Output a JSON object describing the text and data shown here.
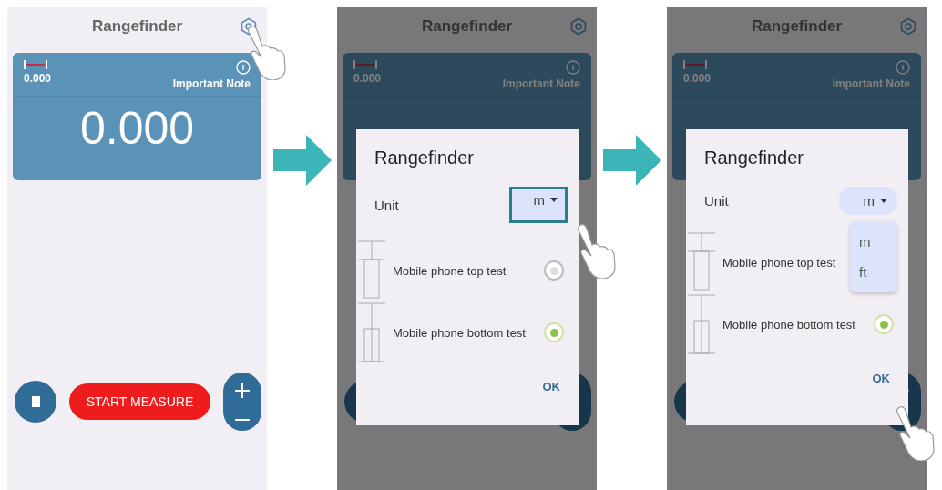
{
  "screens": [
    {
      "title": "Rangefinder",
      "reading": "0.000",
      "note": "Important Note",
      "value": "0.000",
      "start_label": "START MEASURE",
      "settings_tapped": true
    },
    {
      "title": "Rangefinder",
      "reading": "0.000",
      "note": "Important Note",
      "dialog": {
        "title": "Rangefinder",
        "unit_label": "Unit",
        "unit_value": "m",
        "unit_highlighted": true,
        "unit_tapped": true,
        "options": [
          {
            "label": "Mobile phone top test",
            "selected": false,
            "kind": "top"
          },
          {
            "label": "Mobile phone bottom test",
            "selected": true,
            "kind": "bottom"
          }
        ],
        "ok": "OK"
      }
    },
    {
      "title": "Rangefinder",
      "reading": "0.000",
      "note": "Important Note",
      "dialog": {
        "title": "Rangefinder",
        "unit_label": "Unit",
        "unit_value": "m",
        "unit_highlighted": false,
        "unit_menu": [
          "m",
          "ft"
        ],
        "options": [
          {
            "label": "Mobile phone top test",
            "kind": "top"
          },
          {
            "label": "Mobile phone bottom test",
            "selected": true,
            "kind": "bottom"
          }
        ],
        "ok": "OK",
        "ok_tapped": true
      }
    }
  ]
}
